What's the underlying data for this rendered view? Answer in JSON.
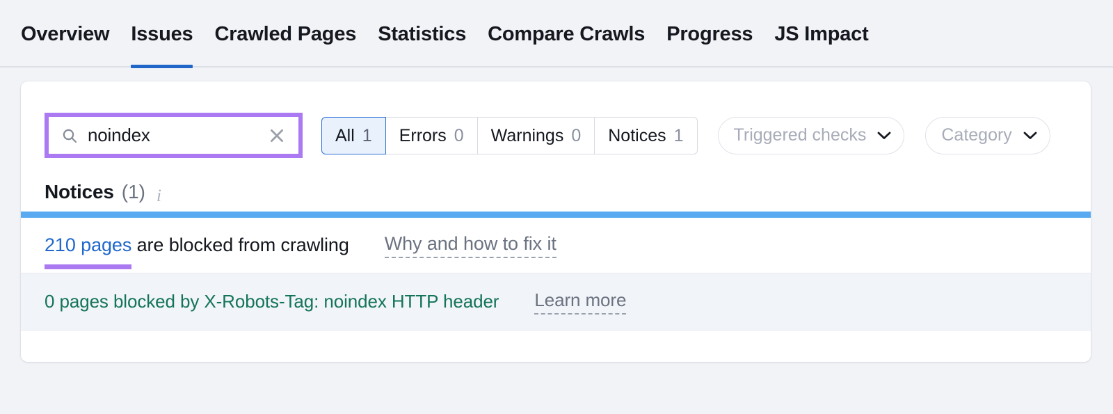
{
  "colors": {
    "page_background": "#f1f3f7",
    "card_background": "#ffffff",
    "active_tab_underline": "#2066c9",
    "annotation_purple": "#ab7af2",
    "notice_severity_bar": "#5aaaf2",
    "link_blue": "#2068cd",
    "sub_issue_green": "#14745a",
    "muted_gray": "#6b7280",
    "segment_selected_border": "#2c6fd4",
    "segment_selected_fill": "#e9f1fd"
  },
  "tabs": [
    {
      "label": "Overview",
      "active": false
    },
    {
      "label": "Issues",
      "active": true
    },
    {
      "label": "Crawled Pages",
      "active": false
    },
    {
      "label": "Statistics",
      "active": false
    },
    {
      "label": "Compare Crawls",
      "active": false
    },
    {
      "label": "Progress",
      "active": false
    },
    {
      "label": "JS Impact",
      "active": false
    }
  ],
  "filters": {
    "search": {
      "value": "noindex",
      "placeholder": "Search",
      "search_icon": "search-icon",
      "clear_icon": "close-icon",
      "annotated": true
    },
    "segments": [
      {
        "label": "All",
        "count": "1",
        "selected": true
      },
      {
        "label": "Errors",
        "count": "0",
        "selected": false
      },
      {
        "label": "Warnings",
        "count": "0",
        "selected": false
      },
      {
        "label": "Notices",
        "count": "1",
        "selected": false
      }
    ],
    "dropdowns": [
      {
        "label": "Triggered checks",
        "chevron_icon": "chevron-down-icon"
      },
      {
        "label": "Category",
        "chevron_icon": "chevron-down-icon"
      }
    ]
  },
  "section": {
    "title": "Notices",
    "count": "(1)",
    "info_icon": "info-icon"
  },
  "issues": [
    {
      "link_text": "210 pages",
      "rest_text": " are blocked from crawling",
      "fix_link": "Why and how to fix it",
      "annotated": true
    }
  ],
  "sub_issues": [
    {
      "text": "0 pages blocked by X-Robots-Tag: noindex HTTP header",
      "learn_link": "Learn more"
    }
  ]
}
